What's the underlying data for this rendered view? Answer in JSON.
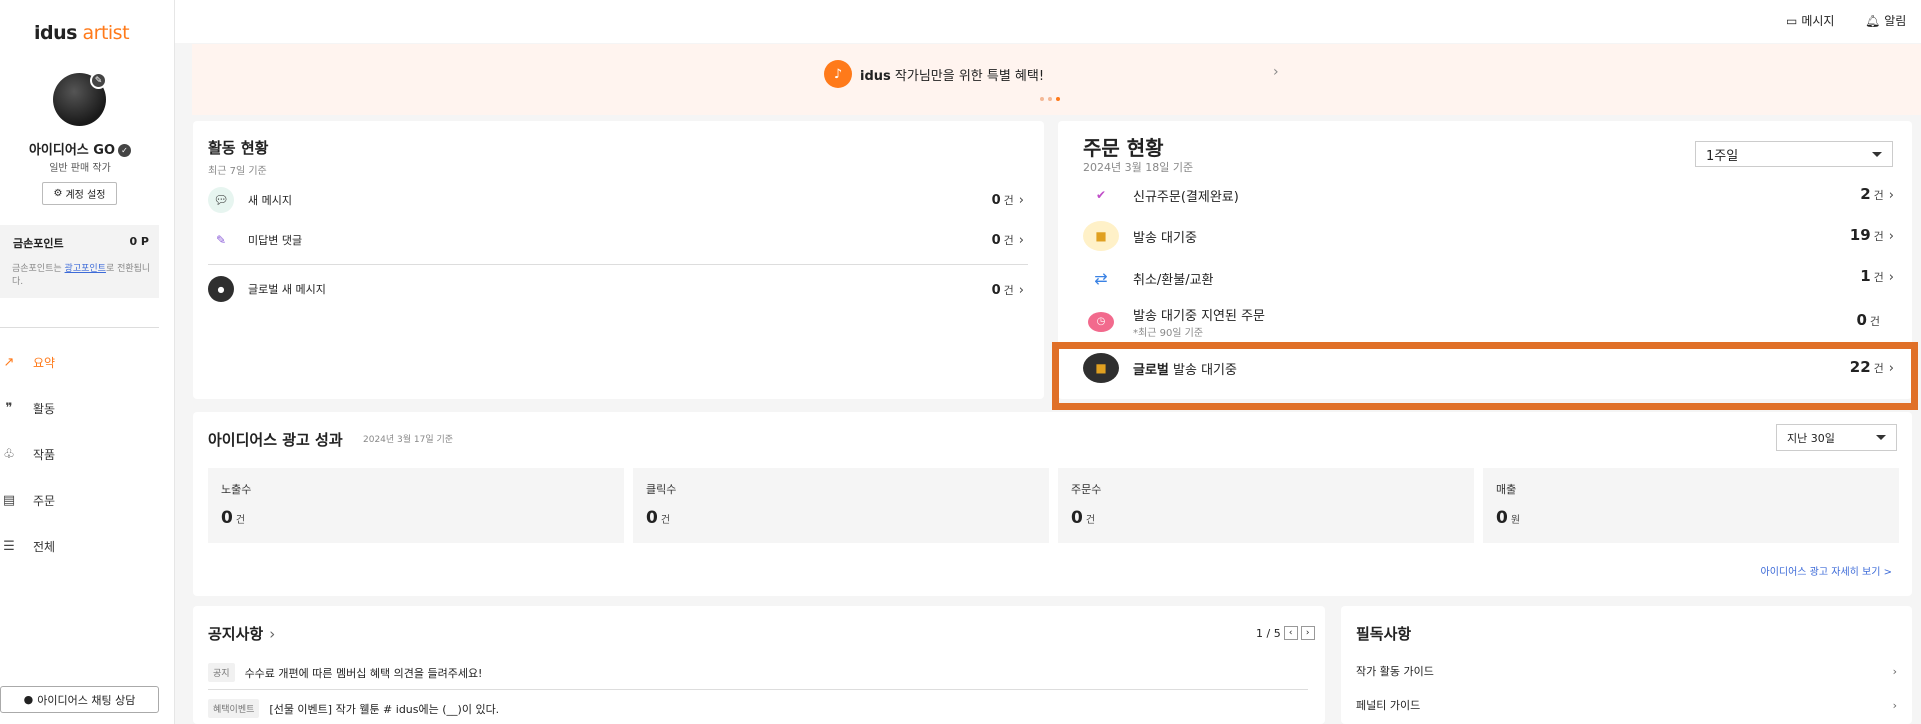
{
  "brand": {
    "logo_main": "idus",
    "logo_sub": " artist"
  },
  "profile": {
    "name": "아이디어스 GO",
    "subtitle": "일반 판매 작가",
    "account_button": "계정 설정"
  },
  "points": {
    "label": "금손포인트",
    "value": "0 P",
    "note_prefix": "금손포인트는 ",
    "note_link": "광고포인트",
    "note_suffix": "로 전환됩니다."
  },
  "nav": [
    {
      "label": "요약",
      "icon": "trend-icon",
      "active": true
    },
    {
      "label": "활동",
      "icon": "quote-icon"
    },
    {
      "label": "작품",
      "icon": "plant-icon"
    },
    {
      "label": "주문",
      "icon": "receipt-icon"
    },
    {
      "label": "전체",
      "icon": "menu-icon"
    }
  ],
  "chat_button": "아이디어스 채팅 상담",
  "topbar": {
    "messages": "메시지",
    "alerts": "알림"
  },
  "banner": {
    "brand": "idus",
    "text": " 작가님만을 위한 특별 혜택!"
  },
  "activity": {
    "title": "활동 현황",
    "subtitle": "최근 7일 기준",
    "rows": [
      {
        "label": "새 메시지",
        "count": "0",
        "unit": "건"
      },
      {
        "label": "미답변 댓글",
        "count": "0",
        "unit": "건"
      },
      {
        "label": "글로벌 새 메시지",
        "count": "0",
        "unit": "건"
      }
    ]
  },
  "orders": {
    "title": "주문 현황",
    "subtitle": "2024년 3월 18일 기준",
    "period": "1주일",
    "rows": [
      {
        "label": "신규주문(결제완료)",
        "count": "2",
        "unit": "건"
      },
      {
        "label": "발송 대기중",
        "count": "19",
        "unit": "건"
      },
      {
        "label": "취소/환불/교환",
        "count": "1",
        "unit": "건"
      },
      {
        "label": "발송 대기중 지연된 주문",
        "sub": "*최근 90일 기준",
        "count": "0",
        "unit": "건"
      },
      {
        "label_bold": "글로벌",
        "label": " 발송 대기중",
        "count": "22",
        "unit": "건"
      }
    ]
  },
  "ads": {
    "title": "아이디어스 광고 성과",
    "subtitle": "2024년 3월 17일 기준",
    "period": "지난 30일",
    "stats": [
      {
        "label": "노출수",
        "value": "0",
        "unit": "건"
      },
      {
        "label": "클릭수",
        "value": "0",
        "unit": "건"
      },
      {
        "label": "주문수",
        "value": "0",
        "unit": "건"
      },
      {
        "label": "매출",
        "value": "0",
        "unit": "원"
      }
    ],
    "detail_link": "아이디어스 광고 자세히 보기 >"
  },
  "notices": {
    "title": "공지사항",
    "pager": "1 / 5",
    "items": [
      {
        "tag": "공지",
        "text": "수수료 개편에 따른 멤버십 혜택 의견을 들려주세요!"
      },
      {
        "tag": "혜택이벤트",
        "text": "[선물 이벤트] 작가 웰툰 # idus에는 (__)이 있다."
      }
    ]
  },
  "must_read": {
    "title": "필독사항",
    "items": [
      {
        "text": "작가 활동 가이드"
      },
      {
        "text": "페널티 가이드"
      }
    ]
  },
  "colors": {
    "accent": "#ff7a1a",
    "highlight_border": "#e07028",
    "banner_bg": "#fff4ef"
  }
}
